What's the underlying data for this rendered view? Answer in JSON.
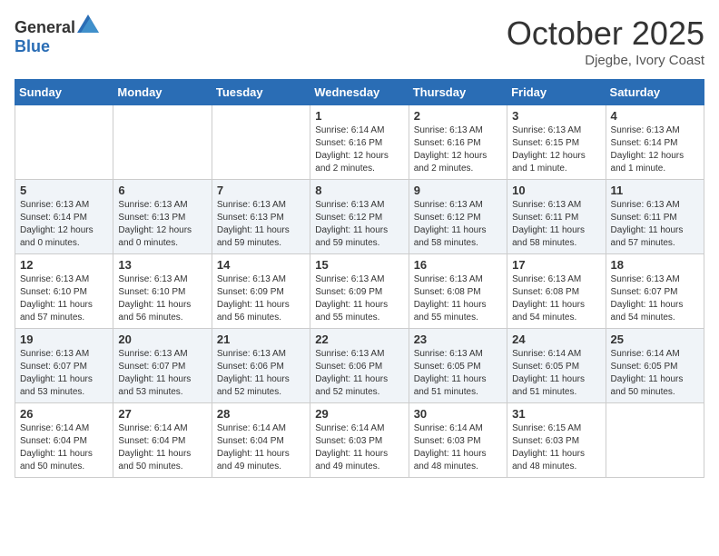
{
  "header": {
    "logo_general": "General",
    "logo_blue": "Blue",
    "month": "October 2025",
    "location": "Djegbe, Ivory Coast"
  },
  "weekdays": [
    "Sunday",
    "Monday",
    "Tuesday",
    "Wednesday",
    "Thursday",
    "Friday",
    "Saturday"
  ],
  "weeks": [
    [
      {
        "day": "",
        "info": ""
      },
      {
        "day": "",
        "info": ""
      },
      {
        "day": "",
        "info": ""
      },
      {
        "day": "1",
        "info": "Sunrise: 6:14 AM\nSunset: 6:16 PM\nDaylight: 12 hours\nand 2 minutes."
      },
      {
        "day": "2",
        "info": "Sunrise: 6:13 AM\nSunset: 6:16 PM\nDaylight: 12 hours\nand 2 minutes."
      },
      {
        "day": "3",
        "info": "Sunrise: 6:13 AM\nSunset: 6:15 PM\nDaylight: 12 hours\nand 1 minute."
      },
      {
        "day": "4",
        "info": "Sunrise: 6:13 AM\nSunset: 6:14 PM\nDaylight: 12 hours\nand 1 minute."
      }
    ],
    [
      {
        "day": "5",
        "info": "Sunrise: 6:13 AM\nSunset: 6:14 PM\nDaylight: 12 hours\nand 0 minutes."
      },
      {
        "day": "6",
        "info": "Sunrise: 6:13 AM\nSunset: 6:13 PM\nDaylight: 12 hours\nand 0 minutes."
      },
      {
        "day": "7",
        "info": "Sunrise: 6:13 AM\nSunset: 6:13 PM\nDaylight: 11 hours\nand 59 minutes."
      },
      {
        "day": "8",
        "info": "Sunrise: 6:13 AM\nSunset: 6:12 PM\nDaylight: 11 hours\nand 59 minutes."
      },
      {
        "day": "9",
        "info": "Sunrise: 6:13 AM\nSunset: 6:12 PM\nDaylight: 11 hours\nand 58 minutes."
      },
      {
        "day": "10",
        "info": "Sunrise: 6:13 AM\nSunset: 6:11 PM\nDaylight: 11 hours\nand 58 minutes."
      },
      {
        "day": "11",
        "info": "Sunrise: 6:13 AM\nSunset: 6:11 PM\nDaylight: 11 hours\nand 57 minutes."
      }
    ],
    [
      {
        "day": "12",
        "info": "Sunrise: 6:13 AM\nSunset: 6:10 PM\nDaylight: 11 hours\nand 57 minutes."
      },
      {
        "day": "13",
        "info": "Sunrise: 6:13 AM\nSunset: 6:10 PM\nDaylight: 11 hours\nand 56 minutes."
      },
      {
        "day": "14",
        "info": "Sunrise: 6:13 AM\nSunset: 6:09 PM\nDaylight: 11 hours\nand 56 minutes."
      },
      {
        "day": "15",
        "info": "Sunrise: 6:13 AM\nSunset: 6:09 PM\nDaylight: 11 hours\nand 55 minutes."
      },
      {
        "day": "16",
        "info": "Sunrise: 6:13 AM\nSunset: 6:08 PM\nDaylight: 11 hours\nand 55 minutes."
      },
      {
        "day": "17",
        "info": "Sunrise: 6:13 AM\nSunset: 6:08 PM\nDaylight: 11 hours\nand 54 minutes."
      },
      {
        "day": "18",
        "info": "Sunrise: 6:13 AM\nSunset: 6:07 PM\nDaylight: 11 hours\nand 54 minutes."
      }
    ],
    [
      {
        "day": "19",
        "info": "Sunrise: 6:13 AM\nSunset: 6:07 PM\nDaylight: 11 hours\nand 53 minutes."
      },
      {
        "day": "20",
        "info": "Sunrise: 6:13 AM\nSunset: 6:07 PM\nDaylight: 11 hours\nand 53 minutes."
      },
      {
        "day": "21",
        "info": "Sunrise: 6:13 AM\nSunset: 6:06 PM\nDaylight: 11 hours\nand 52 minutes."
      },
      {
        "day": "22",
        "info": "Sunrise: 6:13 AM\nSunset: 6:06 PM\nDaylight: 11 hours\nand 52 minutes."
      },
      {
        "day": "23",
        "info": "Sunrise: 6:13 AM\nSunset: 6:05 PM\nDaylight: 11 hours\nand 51 minutes."
      },
      {
        "day": "24",
        "info": "Sunrise: 6:14 AM\nSunset: 6:05 PM\nDaylight: 11 hours\nand 51 minutes."
      },
      {
        "day": "25",
        "info": "Sunrise: 6:14 AM\nSunset: 6:05 PM\nDaylight: 11 hours\nand 50 minutes."
      }
    ],
    [
      {
        "day": "26",
        "info": "Sunrise: 6:14 AM\nSunset: 6:04 PM\nDaylight: 11 hours\nand 50 minutes."
      },
      {
        "day": "27",
        "info": "Sunrise: 6:14 AM\nSunset: 6:04 PM\nDaylight: 11 hours\nand 50 minutes."
      },
      {
        "day": "28",
        "info": "Sunrise: 6:14 AM\nSunset: 6:04 PM\nDaylight: 11 hours\nand 49 minutes."
      },
      {
        "day": "29",
        "info": "Sunrise: 6:14 AM\nSunset: 6:03 PM\nDaylight: 11 hours\nand 49 minutes."
      },
      {
        "day": "30",
        "info": "Sunrise: 6:14 AM\nSunset: 6:03 PM\nDaylight: 11 hours\nand 48 minutes."
      },
      {
        "day": "31",
        "info": "Sunrise: 6:15 AM\nSunset: 6:03 PM\nDaylight: 11 hours\nand 48 minutes."
      },
      {
        "day": "",
        "info": ""
      }
    ]
  ]
}
